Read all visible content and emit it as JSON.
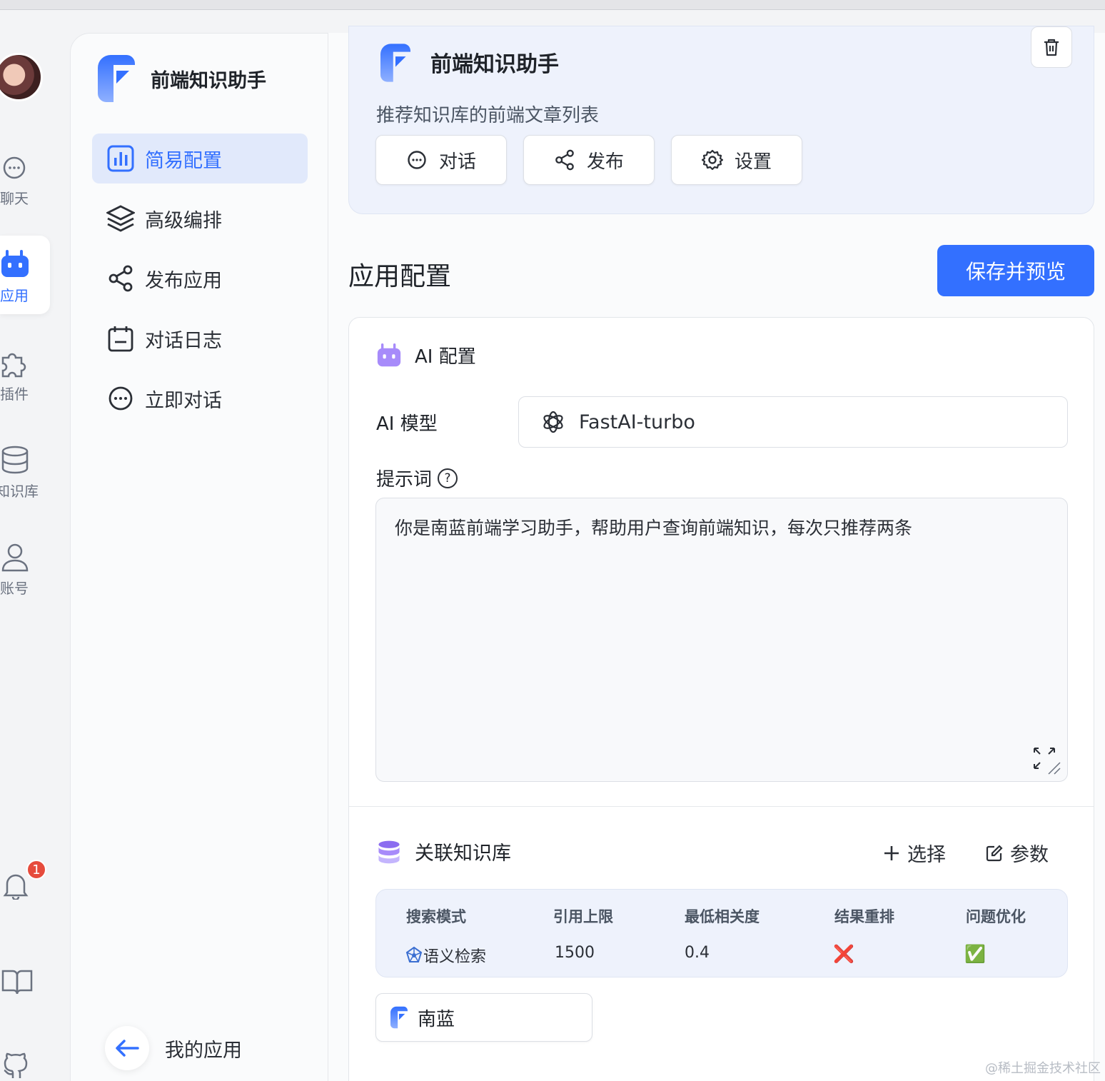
{
  "rail": {
    "items": [
      {
        "label": "聊天",
        "icon": "chat-bubble-icon"
      },
      {
        "label": "应用",
        "icon": "robot-icon",
        "active": true
      },
      {
        "label": "插件",
        "icon": "puzzle-icon"
      },
      {
        "label": "知识库",
        "icon": "database-icon"
      },
      {
        "label": "账号",
        "icon": "user-icon"
      }
    ],
    "notification_count": "1"
  },
  "sidebar": {
    "app_name": "前端知识助手",
    "items": [
      {
        "label": "简易配置",
        "icon": "bar-chart-icon",
        "active": true
      },
      {
        "label": "高级编排",
        "icon": "layers-icon"
      },
      {
        "label": "发布应用",
        "icon": "share-icon"
      },
      {
        "label": "对话日志",
        "icon": "calendar-log-icon"
      },
      {
        "label": "立即对话",
        "icon": "chat-bubble-icon"
      }
    ],
    "back_label": "我的应用"
  },
  "header": {
    "title": "前端知识助手",
    "description": "推荐知识库的前端文章列表",
    "buttons": [
      {
        "label": "对话",
        "icon": "chat-bubble-icon"
      },
      {
        "label": "发布",
        "icon": "share-icon"
      },
      {
        "label": "设置",
        "icon": "gear-icon"
      }
    ]
  },
  "config": {
    "section_title": "应用配置",
    "save_label": "保存并预览",
    "ai_heading": "AI 配置",
    "model_label": "AI 模型",
    "model_value": "FastAI-turbo",
    "prompt_label": "提示词",
    "prompt_help": "?",
    "prompt_value": "你是南蓝前端学习助手，帮助用户查询前端知识，每次只推荐两条",
    "kb_heading": "关联知识库",
    "kb_select_label": "选择",
    "kb_params_label": "参数",
    "kb_table": {
      "headers": [
        "搜索模式",
        "引用上限",
        "最低相关度",
        "结果重排",
        "问题优化"
      ],
      "row": {
        "mode": "语义检索",
        "limit": "1500",
        "min_relevance": "0.4",
        "rerank": "❌",
        "optimize": "✅"
      }
    },
    "kb_items": [
      {
        "name": "南蓝"
      }
    ]
  },
  "watermark": "@稀土掘金技术社区",
  "colors": {
    "accent": "#3370ff",
    "purple": "#8b6cf0",
    "header_bg": "#eef2fc"
  }
}
